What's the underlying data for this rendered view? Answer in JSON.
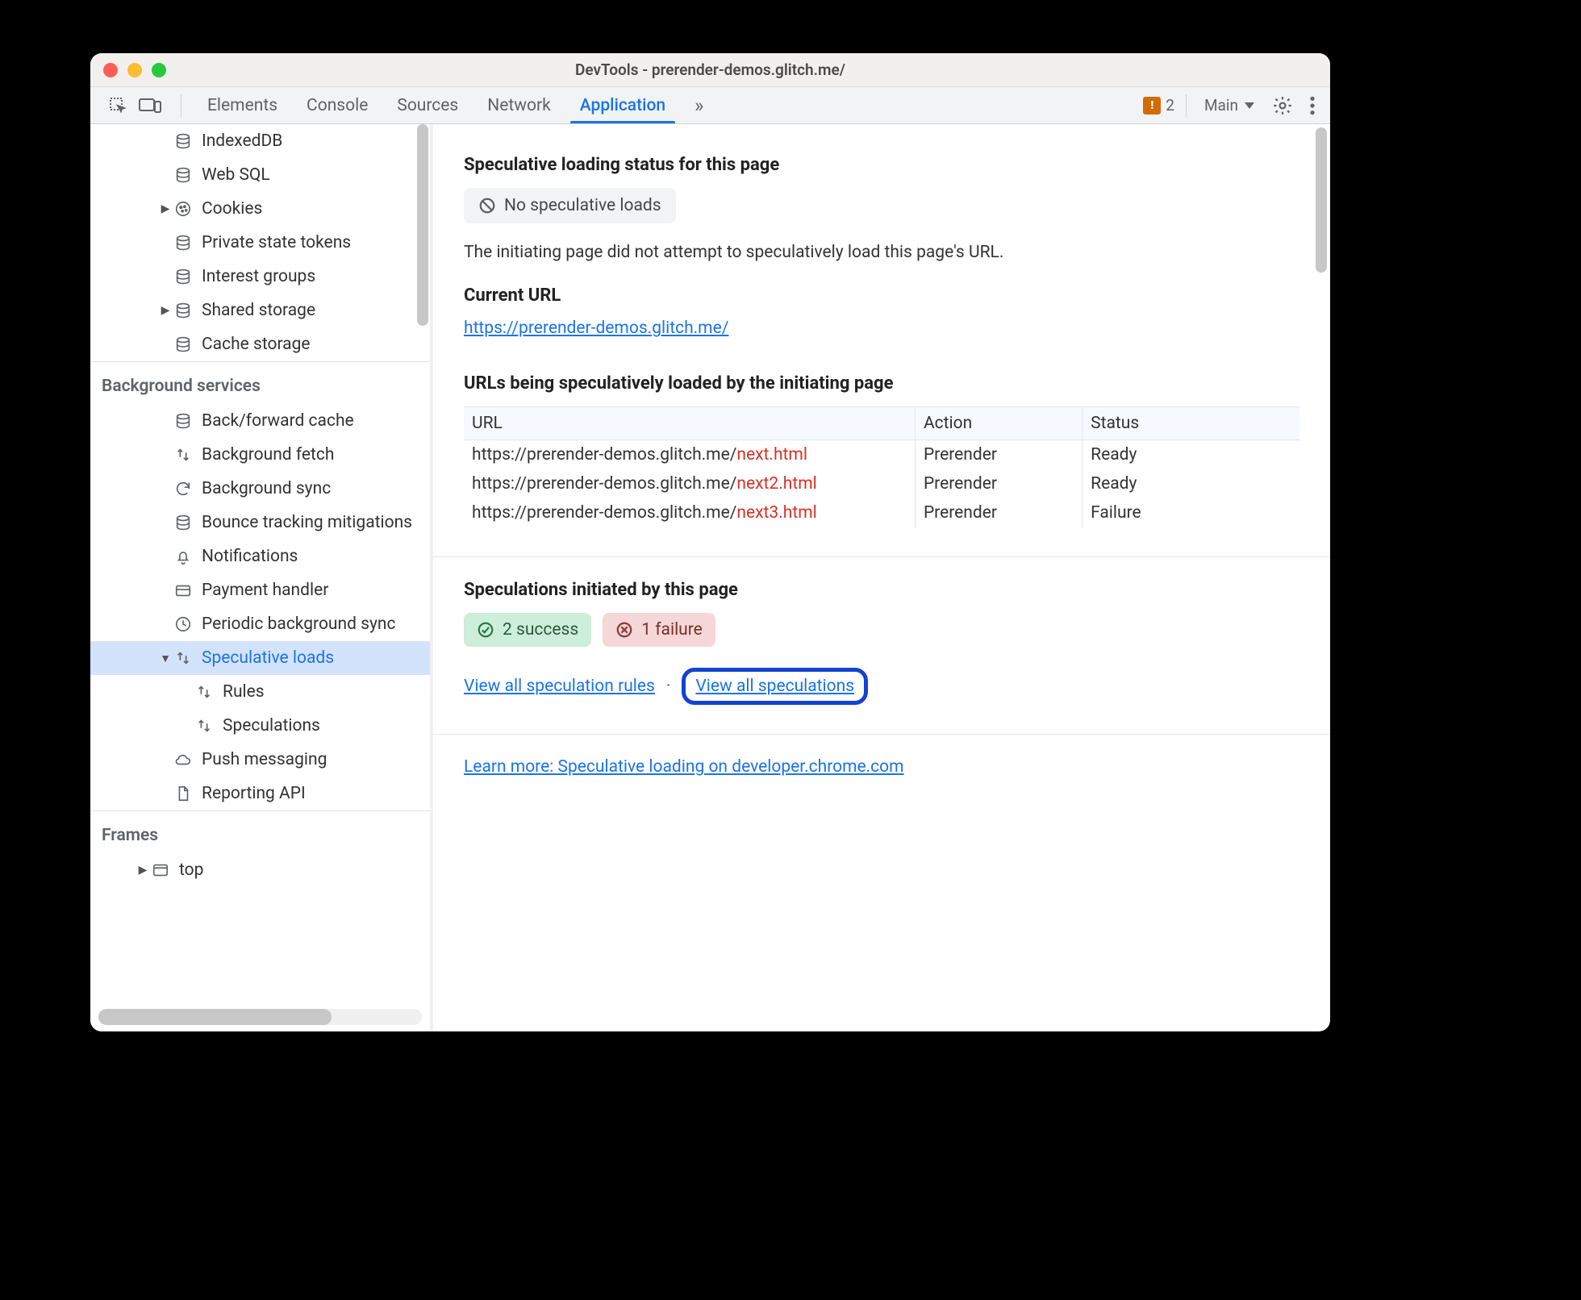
{
  "window": {
    "title": "DevTools - prerender-demos.glitch.me/"
  },
  "toolbar": {
    "tabs": [
      "Elements",
      "Console",
      "Sources",
      "Network",
      "Application"
    ],
    "active_tab_index": 4,
    "more": "»",
    "warn_count": "2",
    "main_label": "Main"
  },
  "sidebar": {
    "storage_items": [
      {
        "label": "IndexedDB",
        "icon": "db"
      },
      {
        "label": "Web SQL",
        "icon": "db"
      },
      {
        "label": "Cookies",
        "icon": "cookie",
        "arrow": true
      },
      {
        "label": "Private state tokens",
        "icon": "db"
      },
      {
        "label": "Interest groups",
        "icon": "db"
      },
      {
        "label": "Shared storage",
        "icon": "db",
        "arrow": true
      },
      {
        "label": "Cache storage",
        "icon": "db"
      }
    ],
    "bg_heading": "Background services",
    "bg_items": [
      {
        "label": "Back/forward cache",
        "icon": "db"
      },
      {
        "label": "Background fetch",
        "icon": "updown"
      },
      {
        "label": "Background sync",
        "icon": "sync"
      },
      {
        "label": "Bounce tracking mitigations",
        "icon": "db"
      },
      {
        "label": "Notifications",
        "icon": "bell"
      },
      {
        "label": "Payment handler",
        "icon": "card"
      },
      {
        "label": "Periodic background sync",
        "icon": "clock"
      },
      {
        "label": "Speculative loads",
        "icon": "updown",
        "selected": true,
        "arrow": "down"
      },
      {
        "label": "Rules",
        "icon": "updown",
        "indent": true
      },
      {
        "label": "Speculations",
        "icon": "updown",
        "indent": true
      },
      {
        "label": "Push messaging",
        "icon": "cloud"
      },
      {
        "label": "Reporting API",
        "icon": "doc"
      }
    ],
    "frames_heading": "Frames",
    "frames_items": [
      {
        "label": "top",
        "icon": "window",
        "arrow": true
      }
    ]
  },
  "pane": {
    "h_status": "Speculative loading status for this page",
    "no_loads": "No speculative loads",
    "desc": "The initiating page did not attempt to speculatively load this page's URL.",
    "h_url": "Current URL",
    "url": "https://prerender-demos.glitch.me/",
    "h_table": "URLs being speculatively loaded by the initiating page",
    "th": [
      "URL",
      "Action",
      "Status"
    ],
    "rows": [
      {
        "prefix": "https://prerender-demos.glitch.me/",
        "suffix": "next.html",
        "action": "Prerender",
        "status": "Ready"
      },
      {
        "prefix": "https://prerender-demos.glitch.me/",
        "suffix": "next2.html",
        "action": "Prerender",
        "status": "Ready"
      },
      {
        "prefix": "https://prerender-demos.glitch.me/",
        "suffix": "next3.html",
        "action": "Prerender",
        "status": "Failure"
      }
    ],
    "h_spec": "Speculations initiated by this page",
    "success": "2 success",
    "failure": "1 failure",
    "link_rules": "View all speculation rules",
    "link_specs": "View all speculations",
    "learn_more": "Learn more: Speculative loading on developer.chrome.com"
  }
}
